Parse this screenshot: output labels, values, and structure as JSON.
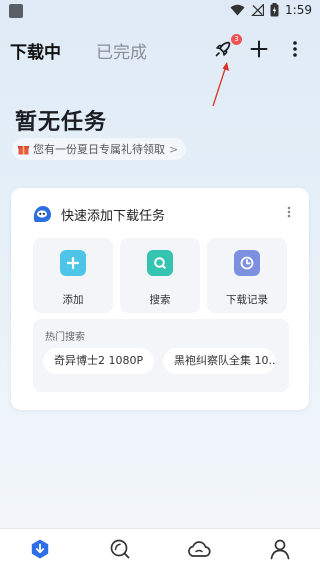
{
  "status_bar": {
    "time": "1:59"
  },
  "header": {
    "tabs": [
      {
        "label": "下载中"
      },
      {
        "label": "已完成"
      }
    ],
    "badge_count": "3",
    "icons": [
      "rocket-icon",
      "plus-icon",
      "more-vertical-icon"
    ]
  },
  "empty_state": {
    "title": "暂无任务",
    "gift_text": "您有一份夏日专属礼待领取",
    "gift_arrow": ">"
  },
  "quick_add": {
    "title": "快速添加下载任务",
    "actions": [
      {
        "label": "添加",
        "color": "#4ec4e8"
      },
      {
        "label": "搜索",
        "color": "#35c4b0"
      },
      {
        "label": "下载记录",
        "color": "#7d90e0"
      }
    ],
    "hot_search": {
      "title": "热门搜索",
      "items": [
        "奇异博士2 1080P",
        "黑袍纠察队全集 10..."
      ]
    }
  },
  "bottom_nav": {
    "items": [
      "download-icon",
      "discover-icon",
      "cloud-icon",
      "profile-icon"
    ],
    "accent_color": "#2f6fe8"
  }
}
